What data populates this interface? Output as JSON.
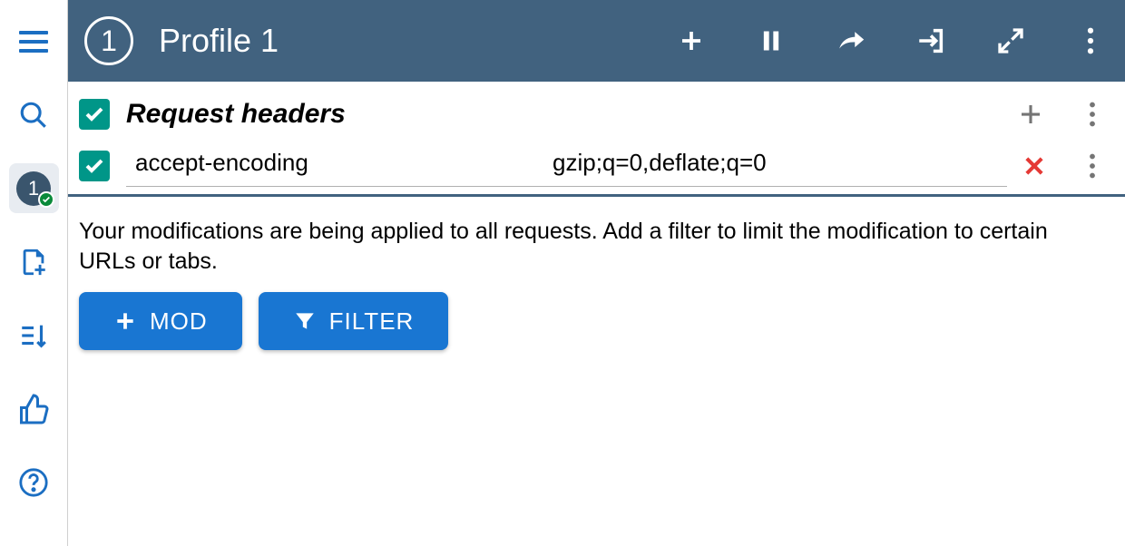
{
  "sidebar": {
    "profile_badge_number": "1"
  },
  "header": {
    "profile_number": "1",
    "title": "Profile 1"
  },
  "section": {
    "title": "Request headers",
    "rows": [
      {
        "name": "accept-encoding",
        "value": "gzip;q=0,deflate;q=0"
      }
    ]
  },
  "info": {
    "text": "Your modifications are being applied to all requests. Add a filter to limit the modification to certain URLs or tabs.",
    "mod_btn": "MOD",
    "filter_btn": "FILTER"
  }
}
